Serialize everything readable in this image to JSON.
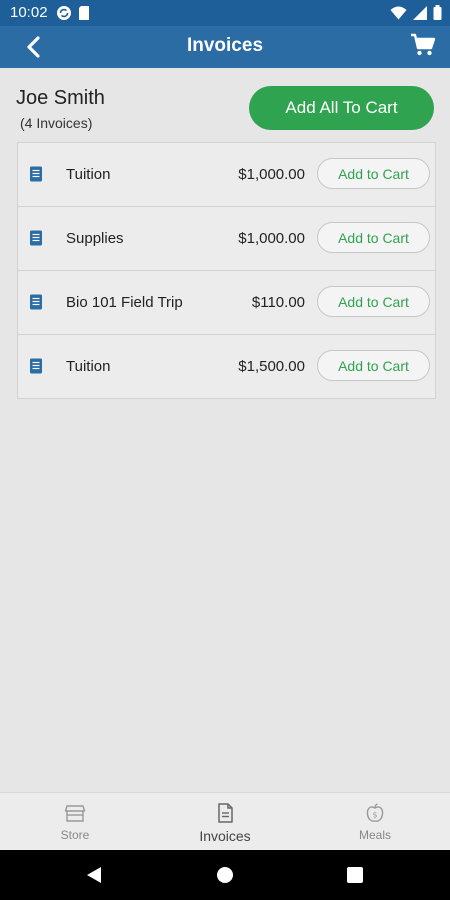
{
  "status_bar": {
    "time": "10:02"
  },
  "app_bar": {
    "title": "Invoices"
  },
  "customer": {
    "name": "Joe Smith",
    "invoice_count": "(4 Invoices)"
  },
  "actions": {
    "add_all_label": "Add All To Cart"
  },
  "invoices": [
    {
      "label": "Tuition",
      "amount": "$1,000.00",
      "button": "Add to Cart"
    },
    {
      "label": "Supplies",
      "amount": "$1,000.00",
      "button": "Add to Cart"
    },
    {
      "label": "Bio 101 Field Trip",
      "amount": "$110.00",
      "button": "Add to Cart"
    },
    {
      "label": "Tuition",
      "amount": "$1,500.00",
      "button": "Add to Cart"
    }
  ],
  "bottom_nav": [
    {
      "label": "Store",
      "icon": "store-icon"
    },
    {
      "label": "Invoices",
      "icon": "invoice-icon",
      "active": true
    },
    {
      "label": "Meals",
      "icon": "meals-icon"
    }
  ],
  "colors": {
    "status_bar": "#1f5f99",
    "app_bar": "#2b6ca5",
    "accent_green": "#2fa34f",
    "doc_icon_blue": "#2b6ca5",
    "background": "#e6e6e6"
  }
}
